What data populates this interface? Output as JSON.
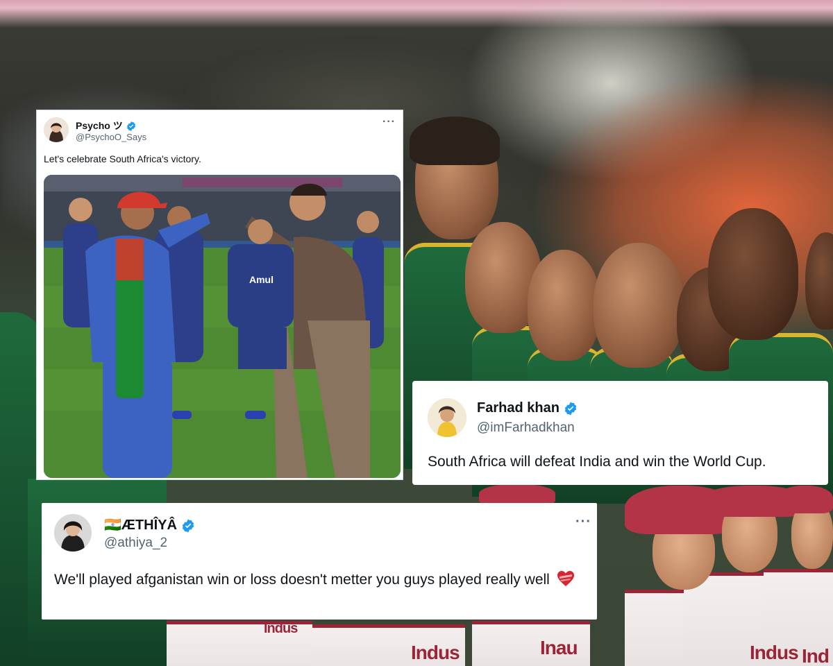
{
  "tweets": [
    {
      "display_name": "Psycho ツ",
      "handle": "@PsychoO_Says",
      "text": "Let's celebrate South Africa's victory.",
      "more_label": "···",
      "has_media": true,
      "media_text": "Amul"
    },
    {
      "display_name": "Farhad khan",
      "handle": "@imFarhadkhan",
      "text": "South Africa will defeat India and win the World Cup."
    },
    {
      "display_name_flag": "🇮🇳",
      "display_name": "ÆTHÎYÂ",
      "handle": "@athiya_2",
      "text": "We'll played afganistan win or loss doesn't metter you guys played really well",
      "more_label": "···"
    }
  ],
  "background_text": [
    "Indus",
    "Indus",
    "Inau",
    "Indus",
    "Ind"
  ],
  "colors": {
    "verified_blue": "#1d9bf0",
    "text_primary": "#0f1419",
    "text_secondary": "#536471",
    "heart_red": "#d8252f",
    "sa_green": "#1f6a3d",
    "afg_blue": "#3d63c2"
  },
  "icons": [
    "verified-badge-icon",
    "more-options-icon",
    "red-heart-icon"
  ]
}
